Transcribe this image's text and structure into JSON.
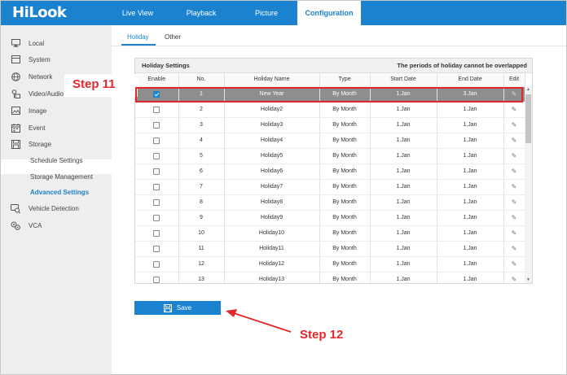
{
  "brand": "HiLook",
  "nav": {
    "tabs": [
      "Live View",
      "Playback",
      "Picture",
      "Configuration"
    ],
    "active": "Configuration"
  },
  "sidebar": {
    "items": [
      {
        "label": "Local",
        "icon": "monitor-icon"
      },
      {
        "label": "System",
        "icon": "system-icon"
      },
      {
        "label": "Network",
        "icon": "globe-icon"
      },
      {
        "label": "Video/Audio",
        "icon": "video-audio-icon"
      },
      {
        "label": "Image",
        "icon": "image-icon"
      },
      {
        "label": "Event",
        "icon": "calendar-icon"
      },
      {
        "label": "Storage",
        "icon": "storage-icon"
      }
    ],
    "storage_sub": [
      "Schedule Settings",
      "Storage Management",
      "Advanced Settings"
    ],
    "extra": [
      {
        "label": "Vehicle Detection",
        "icon": "vehicle-detection-icon"
      },
      {
        "label": "VCA",
        "icon": "vca-icon"
      }
    ]
  },
  "subtabs": [
    "Holiday",
    "Other"
  ],
  "holiday": {
    "title": "Holiday Settings",
    "note": "The periods of holiday cannot be overlapped",
    "columns": [
      "Enable",
      "No.",
      "Holiday Name",
      "Type",
      "Start Date",
      "End Date",
      "Edit"
    ],
    "rows": [
      {
        "no": "1",
        "name": "New Year",
        "type": "By Month",
        "start": "1.Jan",
        "end": "3.Jan"
      },
      {
        "no": "2",
        "name": "Holiday2",
        "type": "By Month",
        "start": "1.Jan",
        "end": "1.Jan"
      },
      {
        "no": "3",
        "name": "Holiday3",
        "type": "By Month",
        "start": "1.Jan",
        "end": "1.Jan"
      },
      {
        "no": "4",
        "name": "Holiday4",
        "type": "By Month",
        "start": "1.Jan",
        "end": "1.Jan"
      },
      {
        "no": "5",
        "name": "Holiday5",
        "type": "By Month",
        "start": "1.Jan",
        "end": "1.Jan"
      },
      {
        "no": "6",
        "name": "Holiday6",
        "type": "By Month",
        "start": "1.Jan",
        "end": "1.Jan"
      },
      {
        "no": "7",
        "name": "Holiday7",
        "type": "By Month",
        "start": "1.Jan",
        "end": "1.Jan"
      },
      {
        "no": "8",
        "name": "Holiday8",
        "type": "By Month",
        "start": "1.Jan",
        "end": "1.Jan"
      },
      {
        "no": "9",
        "name": "Holiday9",
        "type": "By Month",
        "start": "1.Jan",
        "end": "1.Jan"
      },
      {
        "no": "10",
        "name": "Holiday10",
        "type": "By Month",
        "start": "1.Jan",
        "end": "1.Jan"
      },
      {
        "no": "11",
        "name": "Holiday11",
        "type": "By Month",
        "start": "1.Jan",
        "end": "1.Jan"
      },
      {
        "no": "12",
        "name": "Holiday12",
        "type": "By Month",
        "start": "1.Jan",
        "end": "1.Jan"
      },
      {
        "no": "13",
        "name": "Holiday13",
        "type": "By Month",
        "start": "1.Jan",
        "end": "1.Jan"
      }
    ]
  },
  "save_label": "Save",
  "annotations": {
    "step11": "Step 11",
    "step12": "Step 12"
  },
  "colors": {
    "brand_blue": "#1b82cf",
    "annotation_red": "#e3262a",
    "selected_row": "#8e8e8e"
  }
}
